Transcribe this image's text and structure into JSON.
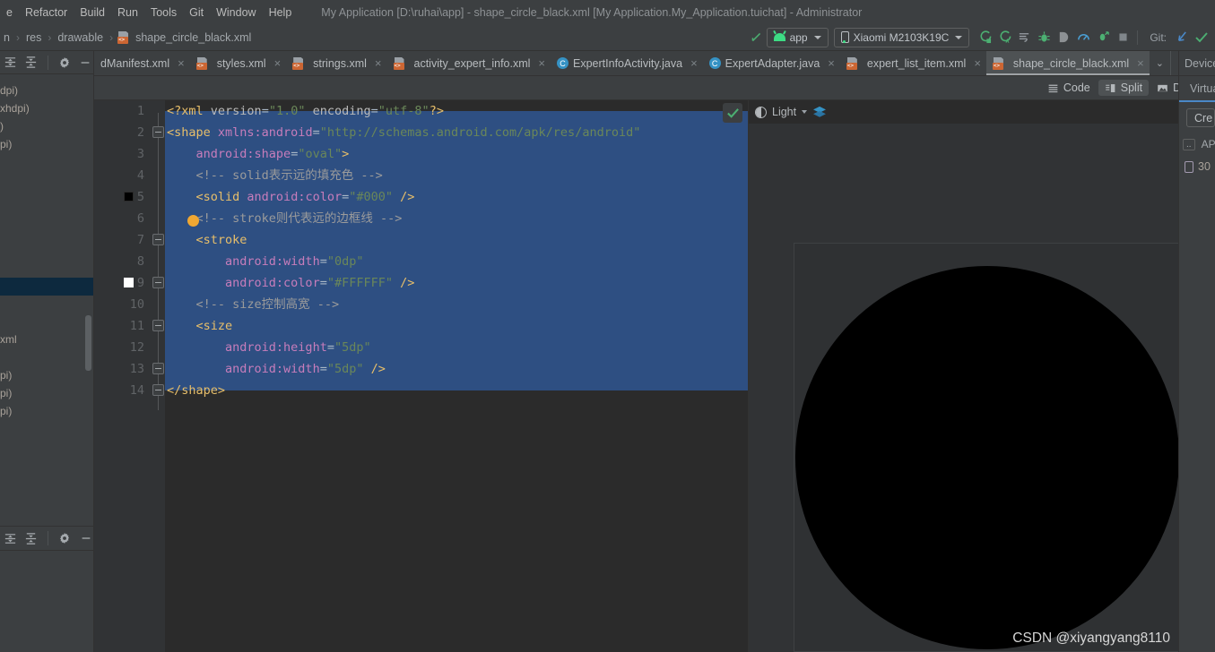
{
  "menubar": {
    "items": [
      "e",
      "Refactor",
      "Build",
      "Run",
      "Tools",
      "Git",
      "Window",
      "Help"
    ],
    "window_title": "My Application [D:\\ruhai\\app] - shape_circle_black.xml [My Application.My_Application.tuichat] - Administrator"
  },
  "navbar": {
    "breadcrumb": [
      "n",
      "res",
      "drawable",
      "shape_circle_black.xml"
    ],
    "separator": "›",
    "run_config": "app",
    "device": "Xiaomi M2103K19C",
    "git_label": "Git:",
    "icons": [
      "run-icon",
      "debug-icon",
      "logcat-icon",
      "profiler-icon",
      "apply-changes-icon",
      "stop-icon",
      "update-project-icon",
      "commit-icon"
    ]
  },
  "left_panel": {
    "toolbar_icons": [
      "collapse-all-icon",
      "expand-all-icon",
      "settings-icon",
      "hide-icon"
    ],
    "tree_fragments": [
      "dpi)",
      "xhdpi)",
      ")",
      "pi)"
    ],
    "tree_fragments2": [
      "xml",
      "pi)",
      "pi)",
      "pi)"
    ]
  },
  "tabs": {
    "items": [
      {
        "label": "dManifest.xml",
        "icon": "xml-file-icon",
        "active": false
      },
      {
        "label": "styles.xml",
        "icon": "xml-file-icon",
        "active": false
      },
      {
        "label": "strings.xml",
        "icon": "xml-file-icon",
        "active": false
      },
      {
        "label": "activity_expert_info.xml",
        "icon": "xml-file-icon",
        "active": false
      },
      {
        "label": "ExpertInfoActivity.java",
        "icon": "java-class-icon",
        "active": false
      },
      {
        "label": "ExpertAdapter.java",
        "icon": "java-class-icon",
        "active": false
      },
      {
        "label": "expert_list_item.xml",
        "icon": "xml-file-icon",
        "active": false
      },
      {
        "label": "shape_circle_black.xml",
        "icon": "xml-file-icon",
        "active": true
      }
    ],
    "close_glyph": "×",
    "overflow_glyph": "⌄",
    "device_label": "Device"
  },
  "modebar": {
    "modes": [
      {
        "label": "Code",
        "selected": false,
        "icon": "code-lines-icon"
      },
      {
        "label": "Split",
        "selected": true,
        "icon": "split-view-icon"
      },
      {
        "label": "Design",
        "selected": false,
        "icon": "design-image-icon"
      }
    ],
    "virtual_label": "Virtu"
  },
  "editor": {
    "line_numbers": [
      "1",
      "2",
      "3",
      "4",
      "5",
      "6",
      "7",
      "8",
      "9",
      "10",
      "11",
      "12",
      "13",
      "14"
    ],
    "lines": [
      {
        "n": 1,
        "segments": [
          {
            "t": "<?xml ",
            "c": "tag"
          },
          {
            "t": "version",
            "c": "attr"
          },
          {
            "t": "=",
            "c": "punct"
          },
          {
            "t": "\"1.0\"",
            "c": "val"
          },
          {
            "t": " ",
            "c": "plain"
          },
          {
            "t": "encoding",
            "c": "attr"
          },
          {
            "t": "=",
            "c": "punct"
          },
          {
            "t": "\"utf-8\"",
            "c": "val"
          },
          {
            "t": "?>",
            "c": "tag"
          }
        ]
      },
      {
        "n": 2,
        "segments": [
          {
            "t": "<shape ",
            "c": "tag"
          },
          {
            "t": "xmlns:android",
            "c": "ns"
          },
          {
            "t": "=",
            "c": "punct"
          },
          {
            "t": "\"http://schemas.android.com/apk/res/android\"",
            "c": "val"
          }
        ]
      },
      {
        "n": 3,
        "segments": [
          {
            "t": "    ",
            "c": "plain"
          },
          {
            "t": "android:shape",
            "c": "ns"
          },
          {
            "t": "=",
            "c": "punct"
          },
          {
            "t": "\"oval\"",
            "c": "val"
          },
          {
            "t": ">",
            "c": "tag"
          }
        ]
      },
      {
        "n": 4,
        "segments": [
          {
            "t": "    ",
            "c": "plain"
          },
          {
            "t": "<!-- solid表示远的填充色 -->",
            "c": "comment"
          }
        ]
      },
      {
        "n": 5,
        "segments": [
          {
            "t": "    ",
            "c": "plain"
          },
          {
            "t": "<solid ",
            "c": "tag"
          },
          {
            "t": "android:color",
            "c": "ns"
          },
          {
            "t": "=",
            "c": "punct"
          },
          {
            "t": "\"#000\"",
            "c": "val"
          },
          {
            "t": " ",
            "c": "plain"
          },
          {
            "t": "/>",
            "c": "tag"
          }
        ]
      },
      {
        "n": 6,
        "segments": [
          {
            "t": "    ",
            "c": "plain"
          },
          {
            "t": "<!-- stroke则代表远的边框线 -->",
            "c": "comment"
          }
        ]
      },
      {
        "n": 7,
        "segments": [
          {
            "t": "    ",
            "c": "plain"
          },
          {
            "t": "<stroke",
            "c": "tag"
          }
        ]
      },
      {
        "n": 8,
        "segments": [
          {
            "t": "        ",
            "c": "plain"
          },
          {
            "t": "android:width",
            "c": "ns"
          },
          {
            "t": "=",
            "c": "punct"
          },
          {
            "t": "\"0dp\"",
            "c": "val"
          }
        ]
      },
      {
        "n": 9,
        "segments": [
          {
            "t": "        ",
            "c": "plain"
          },
          {
            "t": "android:color",
            "c": "ns"
          },
          {
            "t": "=",
            "c": "punct"
          },
          {
            "t": "\"#FFFFFF\"",
            "c": "val"
          },
          {
            "t": " ",
            "c": "plain"
          },
          {
            "t": "/>",
            "c": "tag"
          }
        ]
      },
      {
        "n": 10,
        "segments": [
          {
            "t": "    ",
            "c": "plain"
          },
          {
            "t": "<!-- size控制高宽 -->",
            "c": "comment"
          }
        ]
      },
      {
        "n": 11,
        "segments": [
          {
            "t": "    ",
            "c": "plain"
          },
          {
            "t": "<size",
            "c": "tag"
          }
        ]
      },
      {
        "n": 12,
        "segments": [
          {
            "t": "        ",
            "c": "plain"
          },
          {
            "t": "android:height",
            "c": "ns"
          },
          {
            "t": "=",
            "c": "punct"
          },
          {
            "t": "\"5dp\"",
            "c": "val"
          }
        ]
      },
      {
        "n": 13,
        "segments": [
          {
            "t": "        ",
            "c": "plain"
          },
          {
            "t": "android:width",
            "c": "ns"
          },
          {
            "t": "=",
            "c": "punct"
          },
          {
            "t": "\"5dp\"",
            "c": "val"
          },
          {
            "t": " ",
            "c": "plain"
          },
          {
            "t": "/>",
            "c": "tag"
          }
        ]
      },
      {
        "n": 14,
        "segments": [
          {
            "t": "</shape>",
            "c": "tag"
          }
        ]
      }
    ],
    "gutter_color_swatches": [
      {
        "line": 5,
        "color": "#000000"
      },
      {
        "line": 9,
        "color": "#FFFFFF"
      }
    ],
    "inspection_status": "ok-checkmark",
    "selection_color": "#2e4f82"
  },
  "preview": {
    "theme_label": "Light",
    "theme_icon": "contrast-circle-icon",
    "layers_icon": "layers-icon",
    "watermark": "CSDN @xiyangyang8110",
    "shape_color": "#000000"
  },
  "right_rail": {
    "device_tab": "Device",
    "virtual_tab": "Virtua",
    "create_button": "Cre",
    "api_header": "API",
    "api_dots": "..",
    "api_level": "30"
  },
  "colors": {
    "chrome": "#3c3f41",
    "editor_bg": "#2b2b2b",
    "gutter_bg": "#313335",
    "accent_blue": "#4a88c7",
    "android_green": "#3ddc84",
    "xml_orange": "#cc6633",
    "selection": "#2e4f82"
  }
}
